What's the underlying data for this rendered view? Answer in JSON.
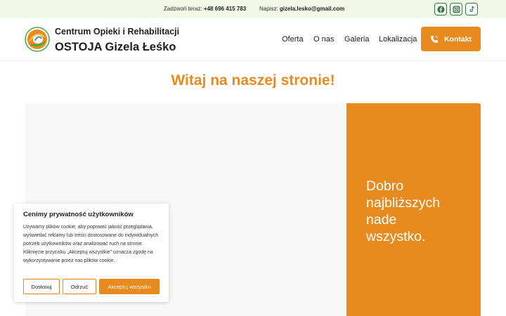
{
  "topbar": {
    "phone_label": "Zadzwoń teraz:",
    "phone_value": "+48 696 415 783",
    "email_label": "Napisz:",
    "email_value": "gizela.lesko@gmail.com",
    "social": [
      "facebook-icon",
      "instagram-icon",
      "tiktok-icon"
    ]
  },
  "header": {
    "brand_line1": "Centrum Opieki i Rehabilitacji",
    "brand_line2": "OSTOJA Gizela Łeśko",
    "nav": [
      "Oferta",
      "O nas",
      "Galeria",
      "Lokalizacja"
    ],
    "cta_label": "Kontakt"
  },
  "hero": {
    "welcome": "Witaj na naszej stronie!",
    "tagline": "Dobro\nnajbliższych\nnade\nwszystko."
  },
  "cookie": {
    "title": "Cenimy prywatność użytkowników",
    "text": "Używamy plików cookie, aby poprawić jakość przeglądania, wyświetlać reklamy lub treści dostosowane do indywidualnych potrzeb użytkowników oraz analizować ruch na stronie. Kliknięcie przycisku „Akceptuj wszystkie” oznacza zgodę na wykorzystywanie przez nas plików cookie.",
    "btn_customize": "Dostosuj",
    "btn_reject": "Odrzuć",
    "btn_accept": "Akceptuj wszystko"
  },
  "colors": {
    "accent": "#e88a1e",
    "topbar_bg": "#eef8e4",
    "social_green": "#2d7a3b"
  }
}
